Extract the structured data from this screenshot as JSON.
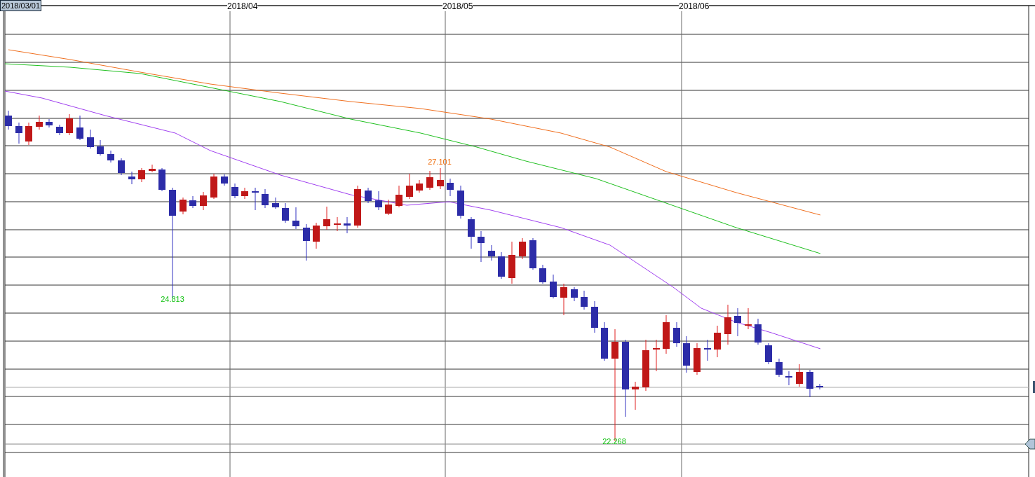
{
  "date_badge": "2018/03/01",
  "x_axis_labels": [
    "2018/04",
    "2018/05",
    "2018/06"
  ],
  "annotations": [
    {
      "text": "27.101",
      "kind": "high"
    },
    {
      "text": "24.813",
      "kind": "low"
    },
    {
      "text": "22.268",
      "kind": "low"
    }
  ]
}
